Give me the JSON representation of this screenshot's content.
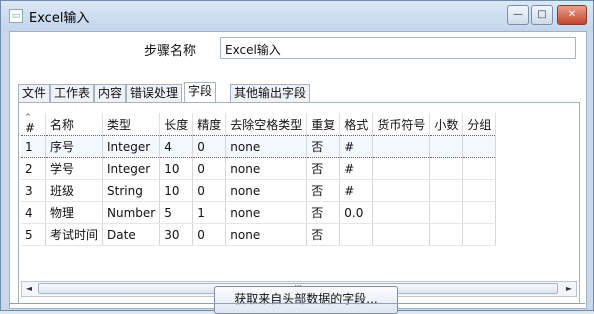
{
  "window": {
    "title": "Excel输入",
    "icon": "document-icon",
    "minimize": "—",
    "maximize": "□",
    "close": "✕"
  },
  "step": {
    "label": "步骤名称",
    "value": "Excel输入"
  },
  "tabs": [
    {
      "label": "文件",
      "active": false
    },
    {
      "label": "工作表",
      "active": false
    },
    {
      "label": "内容",
      "active": false
    },
    {
      "label": "错误处理",
      "active": false
    },
    {
      "label": "字段",
      "active": true
    },
    {
      "label": "其他输出字段",
      "active": false
    }
  ],
  "table": {
    "sort_marker": "^",
    "columns": [
      "#",
      "名称",
      "类型",
      "长度",
      "精度",
      "去除空格类型",
      "重复",
      "格式",
      "货币符号",
      "小数",
      "分组"
    ],
    "rows": [
      [
        "1",
        "序号",
        "Integer",
        "4",
        "0",
        "none",
        "否",
        "#",
        "",
        "",
        ""
      ],
      [
        "2",
        "学号",
        "Integer",
        "10",
        "0",
        "none",
        "否",
        "#",
        "",
        "",
        ""
      ],
      [
        "3",
        "班级",
        "String",
        "10",
        "0",
        "none",
        "否",
        "#",
        "",
        "",
        ""
      ],
      [
        "4",
        "物理",
        "Number",
        "5",
        "1",
        "none",
        "否",
        "0.0",
        "",
        "",
        ""
      ],
      [
        "5",
        "考试时间",
        "Date",
        "30",
        "0",
        "none",
        "否",
        "",
        "",
        "",
        ""
      ]
    ]
  },
  "scrollbar": {
    "left": "◄",
    "right": "►",
    "grip": "III"
  },
  "button": {
    "get_fields": "获取来自头部数据的字段..."
  }
}
